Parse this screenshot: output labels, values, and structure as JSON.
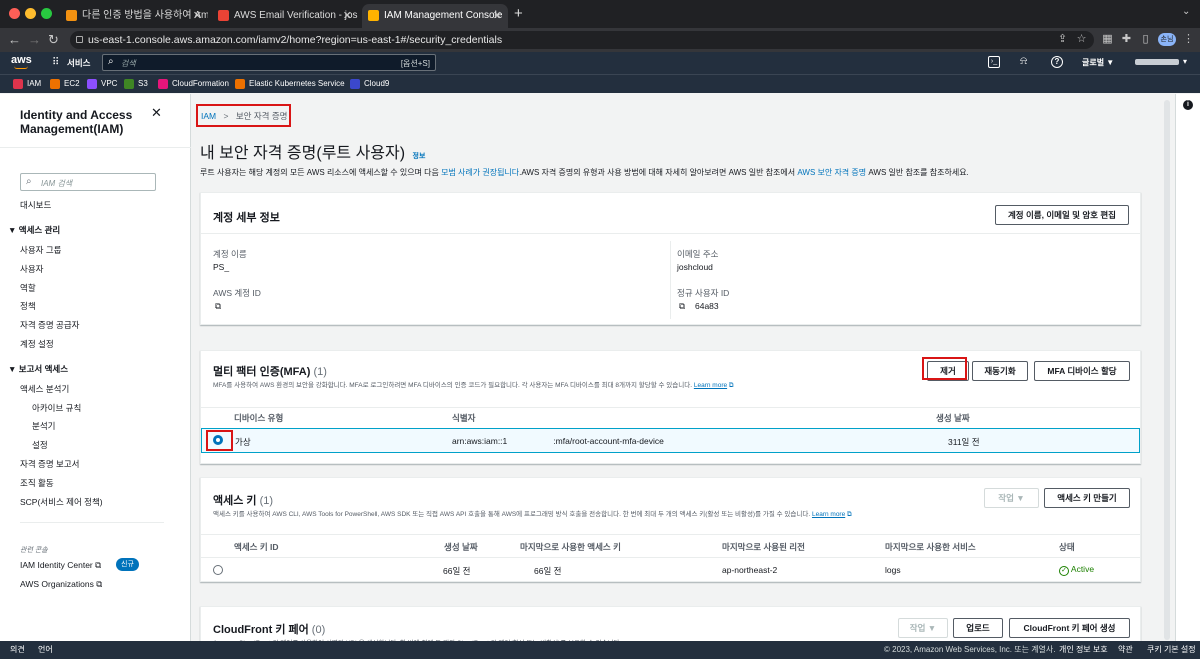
{
  "browser": {
    "tabs": [
      {
        "label": "다른 인증 방법을 사용하여 Amazon",
        "icon_color": "#f29111"
      },
      {
        "label": "AWS Email Verification - joshcl",
        "icon_color": "#ea4335"
      },
      {
        "label": "IAM Management Console",
        "icon_color": "#ffb300"
      }
    ],
    "url": "us-east-1.console.aws.amazon.com/iamv2/home?region=us-east-1#/security_credentials",
    "profile_badge": "손님"
  },
  "aws_nav": {
    "logo": "aws",
    "services_label": "서비스",
    "search_placeholder": "검색",
    "search_shortcut": "[옵션+S]",
    "region_label": "글로벌 ▼"
  },
  "bookmarks": [
    {
      "label": "IAM",
      "color": "#dd344c"
    },
    {
      "label": "EC2",
      "color": "#ed7100"
    },
    {
      "label": "VPC",
      "color": "#8c4fff"
    },
    {
      "label": "S3",
      "color": "#3f8624"
    },
    {
      "label": "CloudFormation",
      "color": "#e7157b"
    },
    {
      "label": "Elastic Kubernetes Service",
      "color": "#ed7100"
    },
    {
      "label": "Cloud9",
      "color": "#3b48cc"
    }
  ],
  "sidebar": {
    "title": "Identity and Access Management(IAM)",
    "search_placeholder": "IAM 검색",
    "dashboard": "대시보드",
    "access_mgmt": "액세스 관리",
    "access_items": [
      "사용자 그룹",
      "사용자",
      "역할",
      "정책",
      "자격 증명 공급자",
      "계정 설정"
    ],
    "reports": "보고서 액세스",
    "report_items": [
      "액세스 분석기",
      "아카이브 규칙",
      "분석기",
      "설정",
      "자격 증명 보고서",
      "조직 활동",
      "SCP(서비스 제어 정책)"
    ],
    "related": "관련 콘솔",
    "related_items": [
      "IAM Identity Center",
      "AWS Organizations"
    ],
    "new_badge": "신규"
  },
  "breadcrumb": {
    "root": "IAM",
    "current": "보안 자격 증명"
  },
  "page": {
    "title": "내 보안 자격 증명(루트 사용자)",
    "info": "정보",
    "desc_a": "루트 사용자는 해당 계정의 모든 AWS 리소스에 액세스할 수 있으며 다음",
    "desc_link1": "모범 사례가 권장됩니다",
    "desc_b": ".AWS 자격 증명의 유형과 사용 방법에 대해 자세히 알아보려면 AWS 일반 참조에서",
    "desc_link2": "AWS 보안 자격 증명",
    "desc_c": "AWS 일반 참조를 참조하세요."
  },
  "account": {
    "title": "계정 세부 정보",
    "edit_button": "계정 이름, 이메일 및 암호 편집",
    "name_label": "계정 이름",
    "name_value": "PS_",
    "email_label": "이메일 주소",
    "email_value": "joshcloud",
    "id_label": "AWS 계정 ID",
    "canonical_label": "정규 사용자 ID",
    "canonical_value": "64a83"
  },
  "mfa": {
    "title": "멀티 팩터 인증(MFA)",
    "count": "(1)",
    "desc": "MFA를 사용하여 AWS 환경의 보안을 강화합니다. MFA로 로그인하려면 MFA 디바이스의 인증 코드가 필요합니다. 각 사용자는 MFA 디바이스를 최대 8개까지 할당할 수 있습니다.",
    "learn_more": "Learn more",
    "remove": "제거",
    "resync": "재동기화",
    "assign": "MFA 디바이스 할당",
    "columns": [
      "디바이스 유형",
      "식별자",
      "생성 날짜"
    ],
    "row": {
      "type": "가상",
      "id_prefix": "arn:aws:iam::1",
      "id_suffix": ":mfa/root-account-mfa-device",
      "created": "311일 전"
    }
  },
  "access_keys": {
    "title": "액세스 키",
    "count": "(1)",
    "desc": "액세스 키를 사용하여 AWS CLI, AWS Tools for PowerShell, AWS SDK 또는 직접 AWS API 호출을 통해 AWS에 프로그래밍 방식 호출을 전송합니다. 한 번에 최대 두 개의 액세스 키(활성 또는 비활성)를 가질 수 있습니다.",
    "learn_more": "Learn more",
    "actions": "작업 ▼",
    "create": "액세스 키 만들기",
    "columns": [
      "액세스 키 ID",
      "생성 날짜",
      "마지막으로 사용한 액세스 키",
      "마지막으로 사용된 리전",
      "마지막으로 사용한 서비스",
      "상태"
    ],
    "row": {
      "id": "",
      "created": "66일 전",
      "last_used": "66일 전",
      "region": "ap-northeast-2",
      "service": "logs",
      "status": "Active"
    }
  },
  "cloudfront": {
    "title": "CloudFront 키 페어",
    "count": "(0)",
    "desc": "Amazon CloudFront 키 페어를 사용하여 서명된 URL을 생성합니다. 한 번에 최대 두 개의 CloudFront 키 페어(활성 또는 비활성)를 보유할 수 있습니다.",
    "actions": "작업 ▼",
    "upload": "업로드",
    "create": "CloudFront 키 페어 생성"
  },
  "footer": {
    "feedback": "의견",
    "language": "언어",
    "copyright": "© 2023, Amazon Web Services, Inc. 또는 계열사.",
    "privacy": "개인 정보 보호",
    "terms": "약관",
    "cookies": "쿠키 기본 설정"
  },
  "colors": {
    "accent": "#0073bb",
    "highlight": "#d91515",
    "success": "#1d8102",
    "nav": "#232f3e"
  }
}
